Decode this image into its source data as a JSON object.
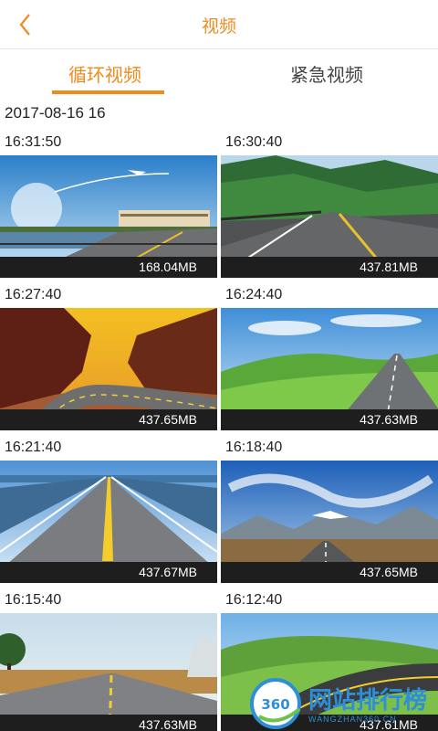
{
  "header": {
    "title": "视频",
    "back_icon": "chevron-left-icon",
    "accent": "#f08a1c"
  },
  "tabs": [
    {
      "label": "循环视频",
      "active": true
    },
    {
      "label": "紧急视频",
      "active": false
    }
  ],
  "group": {
    "date": "2017-08-16 16"
  },
  "videos": [
    {
      "time": "16:31:50",
      "size": "168.04MB"
    },
    {
      "time": "16:30:40",
      "size": "437.81MB"
    },
    {
      "time": "16:27:40",
      "size": "437.65MB"
    },
    {
      "time": "16:24:40",
      "size": "437.63MB"
    },
    {
      "time": "16:21:40",
      "size": "437.67MB"
    },
    {
      "time": "16:18:40",
      "size": "437.65MB"
    },
    {
      "time": "16:15:40",
      "size": "437.63MB"
    },
    {
      "time": "16:12:40",
      "size": "437.61MB"
    }
  ],
  "watermark": {
    "logo": "360",
    "text": "网站排行榜",
    "sub": "WANGZHAN360.CN"
  }
}
